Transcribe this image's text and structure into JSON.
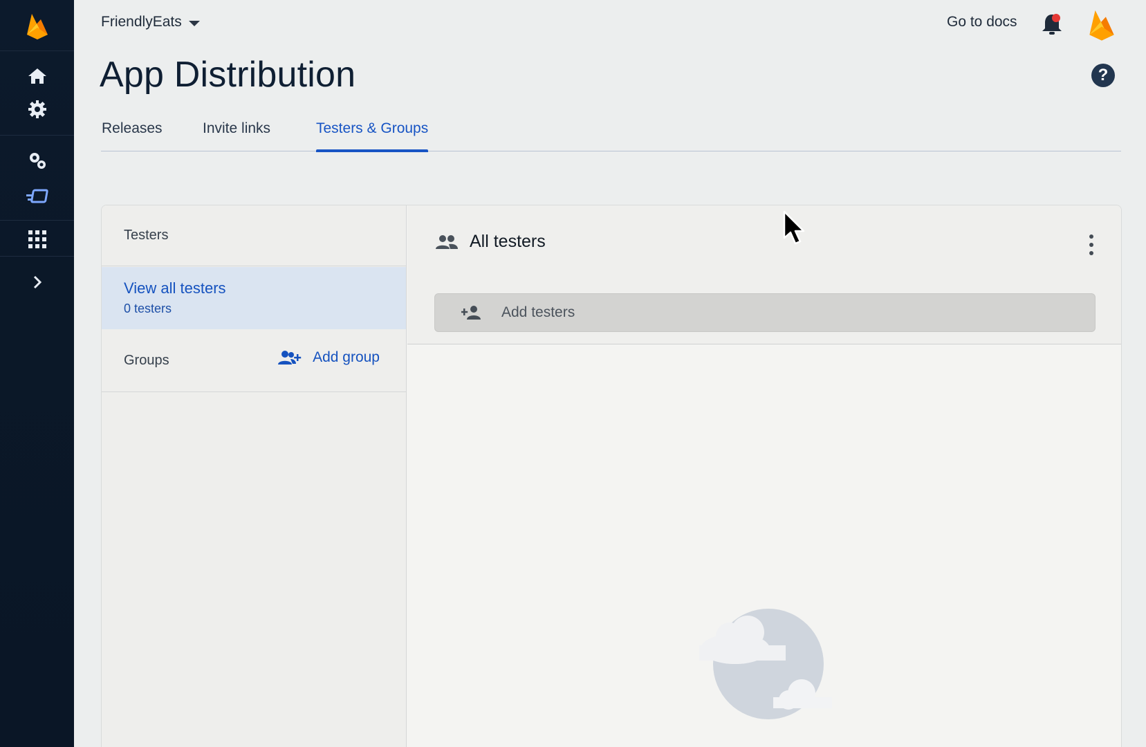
{
  "header": {
    "project_name": "FriendlyEats",
    "docs_link": "Go to docs"
  },
  "page": {
    "title": "App Distribution",
    "help_symbol": "?"
  },
  "tabs": [
    {
      "label": "Releases",
      "active": false
    },
    {
      "label": "Invite links",
      "active": false
    },
    {
      "label": "Testers & Groups",
      "active": true
    }
  ],
  "left_panel": {
    "testers_heading": "Testers",
    "selected_item": {
      "title": "View all testers",
      "subtitle": "0 testers"
    },
    "groups_label": "Groups",
    "add_group_label": "Add group"
  },
  "right_panel": {
    "title": "All testers",
    "add_testers_label": "Add testers"
  },
  "colors": {
    "accent": "#1754c4",
    "sidebar_bg": "#0c1a2c",
    "selected_bg": "#dae4f1",
    "firebase_orange": "#f5a623",
    "notification_dot": "#e53935"
  },
  "icons": {
    "sidebar": [
      "firebase-logo",
      "home-icon",
      "gear-icon",
      "extensions-icon",
      "app-distribution-icon",
      "apps-grid-icon",
      "chevron-right-icon"
    ],
    "header": [
      "caret-down-icon",
      "bell-icon",
      "avatar-firebase-icon",
      "help-icon"
    ],
    "panel": [
      "people-icon",
      "add-person-icon",
      "add-group-icon",
      "more-vert-icon",
      "empty-state-clouds"
    ]
  }
}
